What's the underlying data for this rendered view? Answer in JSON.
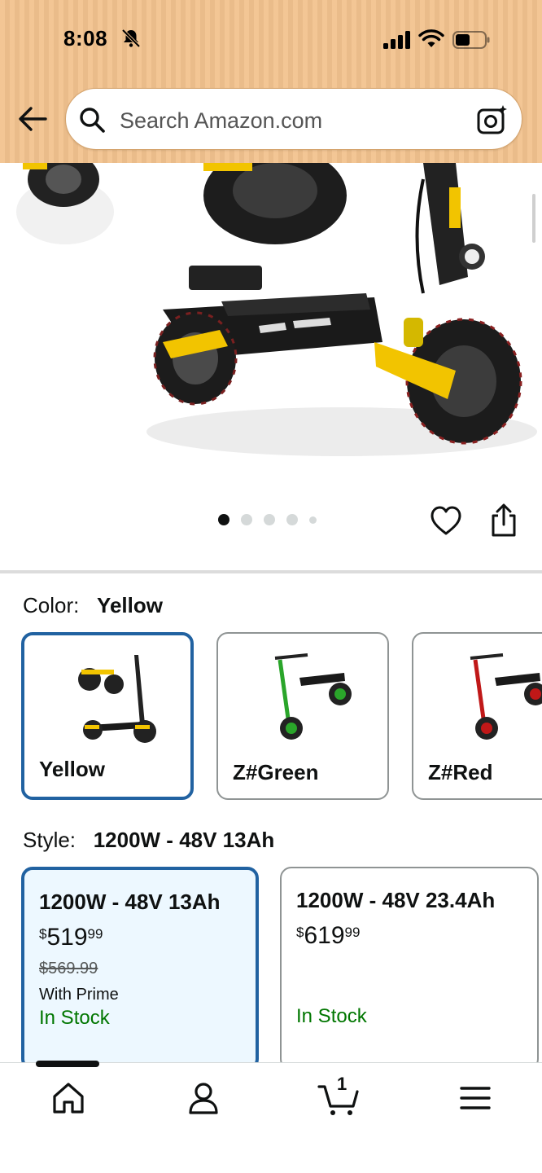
{
  "status_bar": {
    "time": "8:08"
  },
  "search": {
    "placeholder": "Search Amazon.com"
  },
  "gallery": {
    "total_images": 5,
    "active_index": 1
  },
  "color": {
    "label": "Color:",
    "selected": "Yellow",
    "options": [
      {
        "name": "Yellow",
        "accent": "#f2c400"
      },
      {
        "name": "Z#Green",
        "accent": "#2aa52a"
      },
      {
        "name": "Z#Red",
        "accent": "#c01818"
      }
    ]
  },
  "style": {
    "label": "Style:",
    "selected": "1200W - 48V 13Ah",
    "options": [
      {
        "title": "1200W - 48V 13Ah",
        "currency": "$",
        "price_whole": "519",
        "price_fraction": "99",
        "was_price": "$569.99",
        "prime": "With Prime",
        "stock": "In Stock"
      },
      {
        "title": "1200W - 48V 23.4Ah",
        "currency": "$",
        "price_whole": "619",
        "price_fraction": "99",
        "stock": "In Stock"
      }
    ]
  },
  "cart": {
    "count": "1"
  },
  "colors": {
    "header_bg": "#f2c28e",
    "selection_blue": "#2162a1",
    "in_stock_green": "#007600"
  }
}
